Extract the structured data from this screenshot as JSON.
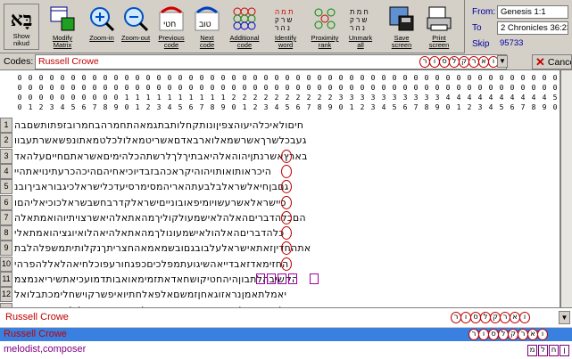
{
  "toolbar": {
    "logo_glyph": "בָּא",
    "buttons": [
      {
        "label": "Show\nnikud",
        "icon": "nikud-logo-icon"
      },
      {
        "label": "Modify\nMatrix",
        "icon": "modify-matrix-icon"
      },
      {
        "label": "Zoom-in",
        "icon": "zoom-in-icon"
      },
      {
        "label": "Zoom-out",
        "icon": "zoom-out-icon"
      },
      {
        "label": "Previous\ncode",
        "icon": "previous-code-icon"
      },
      {
        "label": "Next\ncode",
        "icon": "next-code-icon"
      },
      {
        "label": "Additional\ncode",
        "icon": "additional-code-icon"
      },
      {
        "label": "Identify\nword",
        "icon": "identify-word-icon"
      },
      {
        "label": "Proximity\nrank",
        "icon": "proximity-rank-icon"
      },
      {
        "label": "Unmark\nall",
        "icon": "unmark-all-icon"
      },
      {
        "label": "Save\nscreen",
        "icon": "save-screen-icon"
      },
      {
        "label": "Print\nscreen",
        "icon": "print-screen-icon"
      }
    ]
  },
  "range": {
    "from_label": "From:",
    "from_value": "Genesis 1:1",
    "to_label": "To",
    "to_value": "2 Chronicles 36:23",
    "skip_label": "Skip",
    "skip_value": "95733"
  },
  "codes": {
    "label": "Codes:",
    "value": "Russell Crowe",
    "hebrew_letters": [
      "ר",
      "ו",
      "ס",
      "ל",
      "ק",
      "ר",
      "א",
      "ו"
    ],
    "cancel_label": "Cancel"
  },
  "matrix": {
    "row_numbers": [
      "1",
      "2",
      "3",
      "4",
      "5",
      "6",
      "7",
      "8",
      "9",
      "10",
      "11",
      "12"
    ],
    "rows": [
      "חיםולאיכלהיעוהצפיןונותקחלותבתגמאהתחמרהבחמרובזפתותשםבה",
      "געבכלשרךאשרשמאלוארבאדםאשריטמאלולכלטמאתונפשאשרתעבוו",
      "בארץאשרנתןיהוהאלהיאבתיךלךלרשתהכלהימיםאשראתםחייםעלהאד",
      "היכראותואותויהוהיקראכהבזבדיוכיאחיהםהיכהכרעתינויאתהיי",
      "גםבןחיאלשראלבלבעתהאריהמסימרסיעדכלישראלכיגבוראביךובנ",
      "כיישראלאשרעשויומיפאובונייםישראלקדרבחשבשראלכוכיאליהםו",
      "הםכלהדבריםהאלהלאישמעולקוליךמהאתאלהיאשרצויתיוהואמתאלה",
      "כלהדבריםהאלהולאישמעונולךמהאתאלהיאהלואיוגציהואמתאלי",
      "אתהחדיןזאתאישראלעלבובגםובשמאמאהחצריתךנקלותיתמשפלהלבת",
      "החזימאדזאבדייאהשיגועתמפלכיםכפגחורעפוכלחיאהלאללהפרהי",
      "הקשיבהלתבוןהיהחטיקושחאדאתזמימאואבותדמועכיאתשיריאנמצמ",
      "יאמלתאמןנראזוגאחןזמשםאלפאלחתיואיפשרקוישחלימכתבלואל",
      "ילעבחנוכולהזןאבזפטרהעכוישראלקנוהאיטובוועלולקחםגנוחגרא"
    ],
    "column_number_note": "column index header"
  },
  "found": {
    "line1": "Russell Crowe",
    "line2": "Russell Crowe",
    "line3": "melodist,composer",
    "line3_letters": [
      "מ",
      "ל",
      "ח",
      "ן"
    ]
  },
  "colors": {
    "accent_red": "#c00000",
    "selection_blue": "#3a80e0",
    "purple": "#800080",
    "panel": "#d4d0c8"
  }
}
